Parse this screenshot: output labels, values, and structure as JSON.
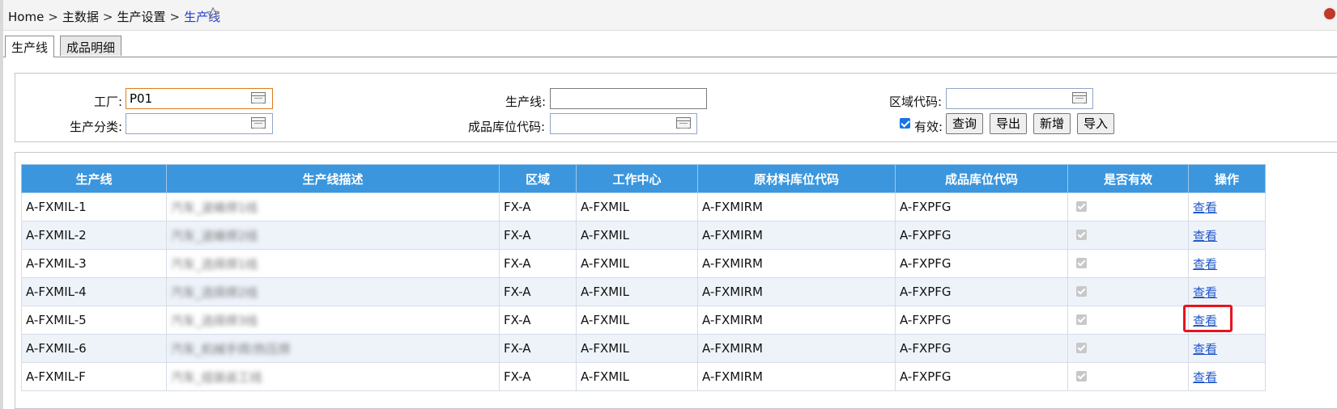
{
  "breadcrumb": {
    "items": [
      "Home",
      "主数据",
      "生产设置"
    ],
    "current": "生产线",
    "separator": ">"
  },
  "tabs": [
    {
      "label": "生产线",
      "active": true
    },
    {
      "label": "成品明细",
      "active": false
    }
  ],
  "filters": {
    "factory": {
      "label": "工厂:",
      "value": "P01"
    },
    "production_line": {
      "label": "生产线:",
      "value": ""
    },
    "area_code": {
      "label": "区域代码:",
      "value": ""
    },
    "production_category": {
      "label": "生产分类:",
      "value": ""
    },
    "product_location_code": {
      "label": "成品库位代码:",
      "value": ""
    },
    "valid": {
      "label": "有效:",
      "checked": true
    }
  },
  "buttons": {
    "query": "查询",
    "export": "导出",
    "add": "新增",
    "import": "导入"
  },
  "table": {
    "columns": [
      "生产线",
      "生产线描述",
      "区域",
      "工作中心",
      "原材料库位代码",
      "成品库位代码",
      "是否有效",
      "操作"
    ],
    "rows": [
      {
        "line": "A-FXMIL-1",
        "desc": "汽车_波峰焊1线",
        "area": "FX-A",
        "work_center": "A-FXMIL",
        "raw_loc": "A-FXMIRM",
        "fg_loc": "A-FXPFG",
        "valid": true,
        "action": "查看"
      },
      {
        "line": "A-FXMIL-2",
        "desc": "汽车_波峰焊2线",
        "area": "FX-A",
        "work_center": "A-FXMIL",
        "raw_loc": "A-FXMIRM",
        "fg_loc": "A-FXPFG",
        "valid": true,
        "action": "查看"
      },
      {
        "line": "A-FXMIL-3",
        "desc": "汽车_选择焊1线",
        "area": "FX-A",
        "work_center": "A-FXMIL",
        "raw_loc": "A-FXMIRM",
        "fg_loc": "A-FXPFG",
        "valid": true,
        "action": "查看"
      },
      {
        "line": "A-FXMIL-4",
        "desc": "汽车_选择焊2线",
        "area": "FX-A",
        "work_center": "A-FXMIL",
        "raw_loc": "A-FXMIRM",
        "fg_loc": "A-FXPFG",
        "valid": true,
        "action": "查看"
      },
      {
        "line": "A-FXMIL-5",
        "desc": "汽车_选择焊3线",
        "area": "FX-A",
        "work_center": "A-FXMIL",
        "raw_loc": "A-FXMIRM",
        "fg_loc": "A-FXPFG",
        "valid": true,
        "action": "查看"
      },
      {
        "line": "A-FXMIL-6",
        "desc": "汽车_机械手焊/热压焊",
        "area": "FX-A",
        "work_center": "A-FXMIL",
        "raw_loc": "A-FXMIRM",
        "fg_loc": "A-FXPFG",
        "valid": true,
        "action": "查看"
      },
      {
        "line": "A-FXMIL-F",
        "desc": "汽车_组装返工线",
        "area": "FX-A",
        "work_center": "A-FXMIL",
        "raw_loc": "A-FXMIRM",
        "fg_loc": "A-FXPFG",
        "valid": true,
        "action": "查看"
      }
    ]
  },
  "icons": {
    "favorite": "star-outline-icon",
    "picker": "calendar-icon"
  },
  "colors": {
    "header_bg": "#3b96dd",
    "link": "#1f56c9",
    "highlight": "#e8141e"
  }
}
